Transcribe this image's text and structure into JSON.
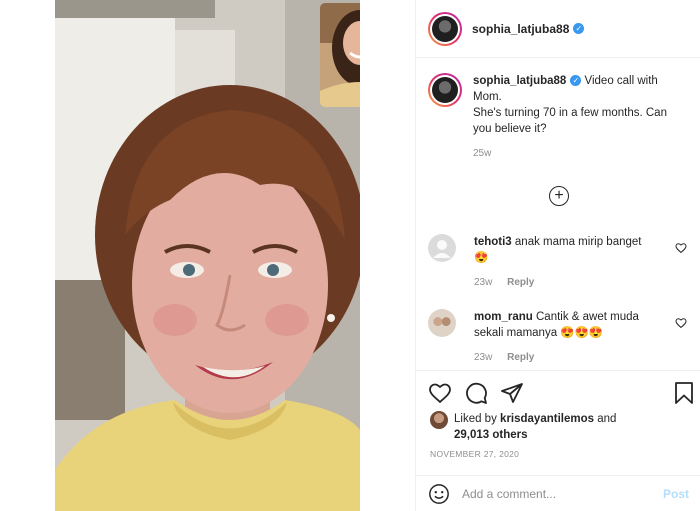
{
  "post": {
    "username": "sophia_latjuba88",
    "verified_icon": "verified-badge-icon",
    "caption_lines": [
      "Video call with",
      "Mom.",
      "She's turning 70 in a few months. Can",
      "you believe it?"
    ],
    "caption_age": "25w",
    "load_more_icon": "plus-circle-icon"
  },
  "comments": [
    {
      "username": "tehoti3",
      "text_line1": "anak mama mirip banget",
      "emoji": "😍",
      "age": "23w",
      "reply_label": "Reply"
    },
    {
      "username": "mom_ranu",
      "text_line1": "Cantik & awet muda",
      "text_line2": "sekali mamanya",
      "emoji": "😍😍😍",
      "age": "23w",
      "reply_label": "Reply"
    }
  ],
  "actions": {
    "liked_by_prefix": "Liked by",
    "liked_by_user": "krisdayantilemos",
    "and_word": "and",
    "others_count": "29,013 others",
    "date": "NOVEMBER 27, 2020"
  },
  "comment_box": {
    "placeholder": "Add a comment...",
    "post_label": "Post",
    "emoji_icon": "smiley-icon"
  },
  "colors": {
    "verified_blue": "#3897f0",
    "muted_text": "#8e8e8e",
    "post_button_disabled": "#b2dffc",
    "sweater_yellow": "#e8d27a"
  }
}
